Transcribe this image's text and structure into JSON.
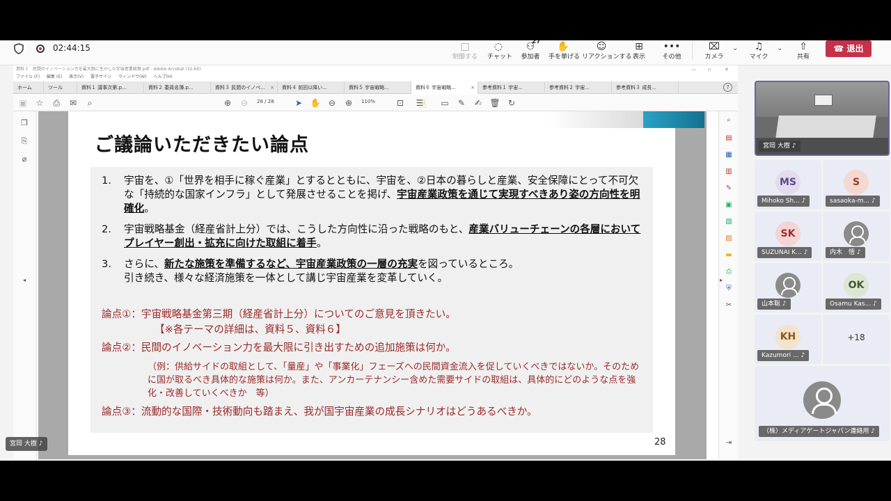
{
  "meeting": {
    "timer": "02:44:15",
    "toolbar": [
      {
        "label": "制御する",
        "icon": "□",
        "disabled": true
      },
      {
        "label": "チャット",
        "icon": "◌"
      },
      {
        "label": "参加者",
        "icon": "⚇",
        "count": "27"
      },
      {
        "label": "手を挙げる",
        "icon": "✋"
      },
      {
        "label": "リアクションする",
        "icon": "☺"
      },
      {
        "label": "表示",
        "icon": "⊞"
      },
      {
        "label": "その他",
        "icon": "•••"
      },
      {
        "label": "カメラ",
        "icon": "⌧"
      },
      {
        "label": "マイク",
        "icon": "♫"
      },
      {
        "label": "共有",
        "icon": "⇧"
      }
    ],
    "leave_label": "退出"
  },
  "acrobat": {
    "window_title": "資料３　民間のイノベーション力を最大限に生かした宇宙産業政策.pdf - Adobe Acrobat (32-bit)",
    "menu": [
      "ファイル (F)",
      "編集 (E)",
      "表示(V)",
      "電子サイン",
      "ウィンドウ(W)",
      "ヘルプ(H)"
    ],
    "tabs": [
      {
        "label": "ホーム"
      },
      {
        "label": "ツール"
      },
      {
        "label": "資料１ 議事次第.p..."
      },
      {
        "label": "資料２ 委員名簿.p..."
      },
      {
        "label": "資料３ 民間のイノベ..."
      },
      {
        "label": "資料４ 前回以降い..."
      },
      {
        "label": "資料５ 宇宙戦略..."
      },
      {
        "label": "資料６ 宇宙戦略..."
      },
      {
        "label": "参考資料１ 宇宙..."
      },
      {
        "label": "参考資料２ 宇宙..."
      },
      {
        "label": "参考資料３ 成長..."
      }
    ],
    "page_current": "28",
    "page_total": "/ 28",
    "zoom": "110%"
  },
  "slide": {
    "title": "ご議論いただきたい論点",
    "items": [
      {
        "num": "1.",
        "text_a": "宇宙を、①「世界を相手に稼ぐ産業」とするとともに、宇宙を、②日本の暮らしと産業、安全保障にとって不可欠な「持続的な国家インフラ」として発展させることを掲げ、",
        "bold": "宇宙産業政策を通じて実現すべきあり姿の方向性を明確化",
        "text_b": "。"
      },
      {
        "num": "2.",
        "text_a": "宇宙戦略基金（経産省計上分）では、こうした方向性に沿った戦略のもと、",
        "bold": "産業バリューチェーンの各層においてプレイヤー創出・拡充に向けた取組に着手",
        "text_b": "。"
      },
      {
        "num": "3.",
        "text_a": "さらに、",
        "bold": "新たな施策を準備するなど、宇宙産業政策の一層の充実",
        "text_b": "を図っているところ。",
        "line2": "引き続き、様々な経済施策を一体として講じ宇宙産業を変革していく。"
      }
    ],
    "point1": "論点①：宇宙戦略基金第三期（経産省計上分）についてのご意見を頂きたい。",
    "point1_ref": "【※各テーマの詳細は、資料５、資料６】",
    "point2": "論点②：民間のイノベーション力を最大限に引き出すための追加施策は何か。",
    "point2_example": "（例：供給サイドの取組として、「量産」や「事業化」フェーズへの民間資金流入を促していくべきではないか。そのために国が取るべき具体的な施策は何か。また、アンカーテナンシー含めた需要サイドの取組は、具体的にどのような点を強化・改善していくべきか　等）",
    "point3": "論点③：流動的な国際・技術動向も踏まえ、我が国宇宙産業の成長シナリオはどうあるべきか。",
    "page_number": "28"
  },
  "participants": {
    "main_speaker": "宮岡 大樹",
    "tiles": [
      {
        "initials": "MS",
        "name": "Mihoko Sh...",
        "bg": "#e3dcef",
        "fg": "#5b4a8a"
      },
      {
        "initials": "S",
        "name": "sasaoka-m...",
        "bg": "#f3d9d2",
        "fg": "#a03a22"
      },
      {
        "initials": "SK",
        "name": "SUZUNAI K...",
        "bg": "#f3d5d5",
        "fg": "#a52b2b"
      },
      {
        "initials": "",
        "name": "内木　悟",
        "bg": "#8a8a8a",
        "fg": "#ffffff"
      },
      {
        "initials": "",
        "name": "山本聡",
        "bg": "#8a8a8a",
        "fg": "#ffffff"
      },
      {
        "initials": "OK",
        "name": "Osamu Kas...",
        "bg": "#dde6d5",
        "fg": "#3f5b2e"
      },
      {
        "initials": "KH",
        "name": "Kazumori ...",
        "bg": "#f3e3cc",
        "fg": "#8a5a1a"
      }
    ],
    "more": "+18",
    "big_tile_name": "（株）メディアゲートジャパン連絡用",
    "bottom_tag": "宮岡 大樹"
  }
}
